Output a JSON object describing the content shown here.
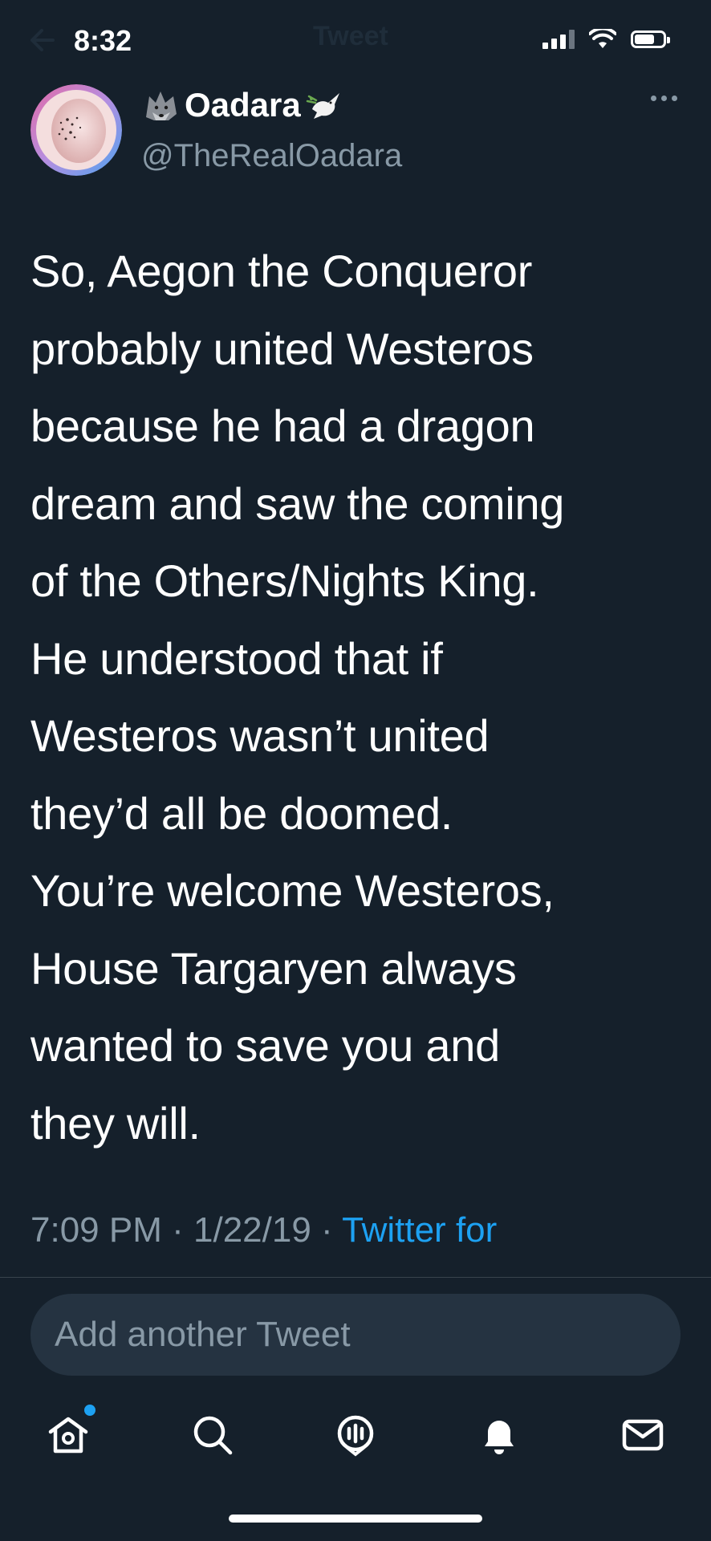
{
  "status_bar": {
    "time": "8:32",
    "header_title": "Tweet"
  },
  "tweet": {
    "author": {
      "display_name": "Oadara",
      "handle": "@TheRealOadara",
      "name_emoji_before": "wolf-icon",
      "name_emoji_after": "dove-icon"
    },
    "text": "So, Aegon the Conqueror\nprobably united Westeros\nbecause he had a dragon\ndream and saw the coming\nof the Others/Nights King.\nHe understood that if\nWesteros wasn’t united\nthey’d all be doomed.\nYou’re welcome Westeros,\nHouse Targaryen always\nwanted to save you and\nthey will.",
    "time": "7:09 PM",
    "date": "1/22/19",
    "separator": "·",
    "source": "Twitter for"
  },
  "compose": {
    "placeholder": "Add another Tweet"
  },
  "tab_bar": {
    "items": [
      "home-icon",
      "search-icon",
      "spaces-icon",
      "notifications-icon",
      "messages-icon"
    ]
  },
  "colors": {
    "background": "#15202b",
    "secondary_text": "#8899a6",
    "accent": "#1da1f2",
    "compose_bg": "#253341"
  }
}
